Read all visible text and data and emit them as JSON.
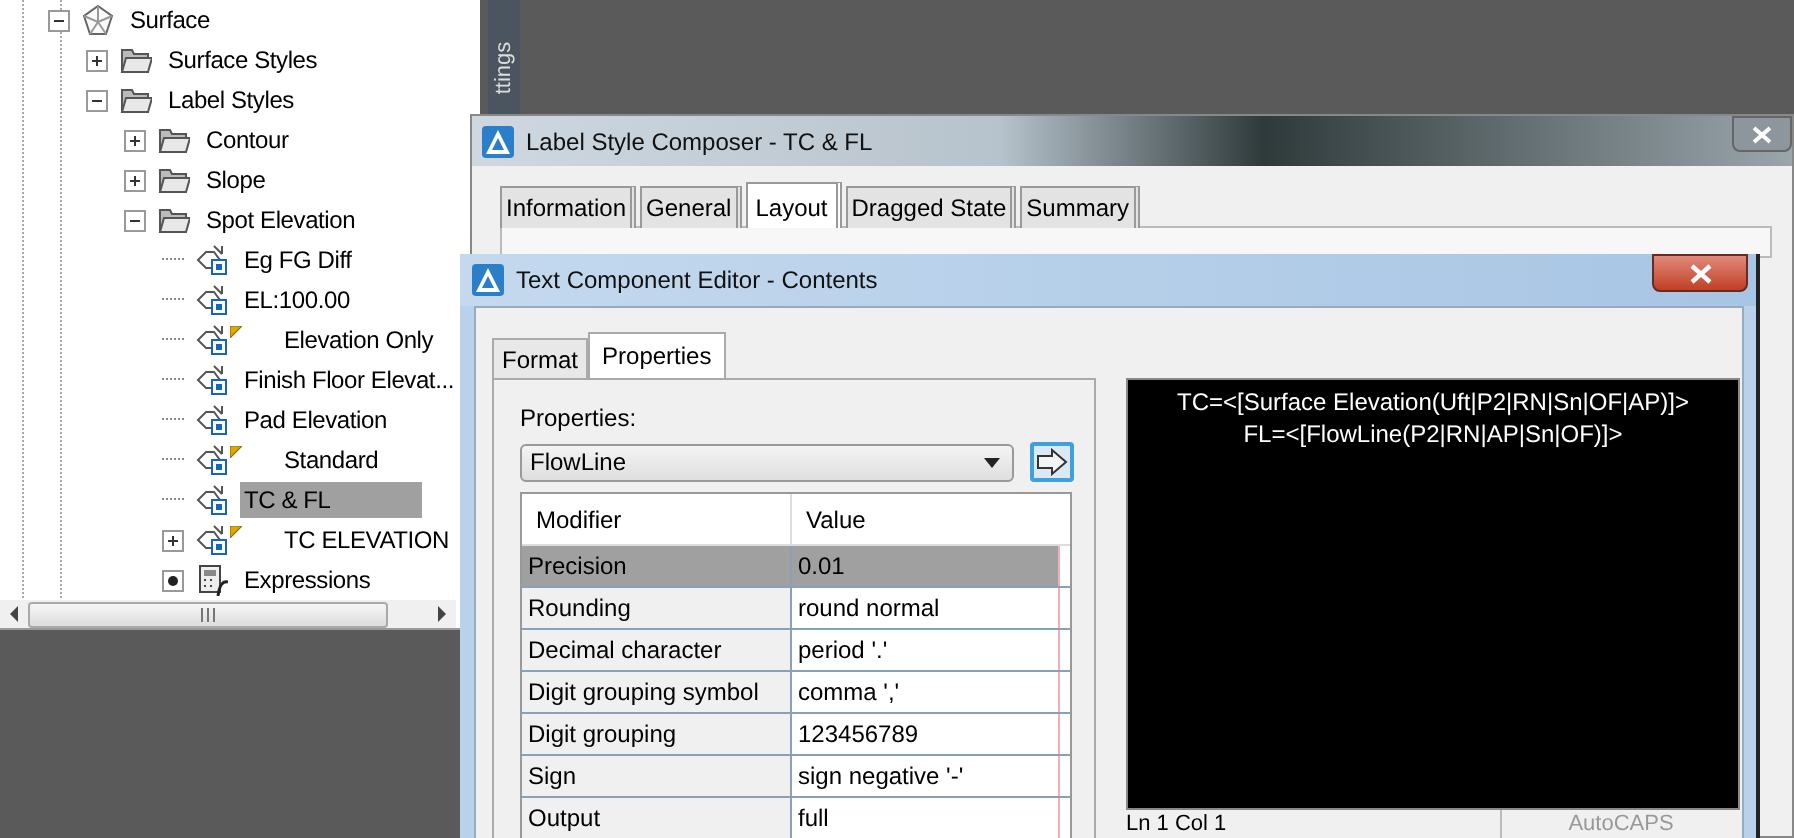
{
  "side_label": "ttings",
  "tree": [
    {
      "label": "Surface",
      "kind": "surface",
      "expanded": true,
      "selected": false,
      "children": [
        {
          "label": "Surface Styles",
          "kind": "folder",
          "expanded": false,
          "selected": false
        },
        {
          "label": "Label Styles",
          "kind": "folder",
          "expanded": true,
          "selected": false,
          "children": [
            {
              "label": "Contour",
              "kind": "folder",
              "expanded": false,
              "selected": false
            },
            {
              "label": "Slope",
              "kind": "folder",
              "expanded": false,
              "selected": false
            },
            {
              "label": "Spot Elevation",
              "kind": "folder",
              "expanded": true,
              "selected": false,
              "children": [
                {
                  "label": "Eg FG Diff",
                  "kind": "label-style",
                  "flagged": false,
                  "selected": false
                },
                {
                  "label": "EL:100.00",
                  "kind": "label-style",
                  "flagged": false,
                  "selected": false
                },
                {
                  "label": "Elevation Only",
                  "kind": "label-style",
                  "flagged": true,
                  "selected": false
                },
                {
                  "label": "Finish Floor Elevat...",
                  "kind": "label-style",
                  "flagged": false,
                  "selected": false
                },
                {
                  "label": "Pad Elevation",
                  "kind": "label-style",
                  "flagged": false,
                  "selected": false
                },
                {
                  "label": "Standard",
                  "kind": "label-style",
                  "flagged": true,
                  "selected": false
                },
                {
                  "label": "TC & FL",
                  "kind": "label-style",
                  "flagged": false,
                  "selected": true
                },
                {
                  "label": "TC ELEVATION",
                  "kind": "label-style",
                  "flagged": true,
                  "expanded": false,
                  "selected": false
                },
                {
                  "label": "Expressions",
                  "kind": "expressions",
                  "selected": false
                }
              ]
            }
          ]
        }
      ]
    }
  ],
  "composer": {
    "title": "Label Style Composer - TC & FL",
    "tabs": [
      {
        "label": "Information",
        "selected": false
      },
      {
        "label": "General",
        "selected": false
      },
      {
        "label": "Layout",
        "selected": true
      },
      {
        "label": "Dragged State",
        "selected": false
      },
      {
        "label": "Summary",
        "selected": false
      }
    ]
  },
  "editor": {
    "title": "Text Component Editor - Contents",
    "tabs": [
      {
        "label": "Format",
        "selected": false
      },
      {
        "label": "Properties",
        "selected": true
      }
    ],
    "properties_label": "Properties:",
    "properties_value": "FlowLine",
    "grid": {
      "columns": [
        "Modifier",
        "Value"
      ],
      "rows": [
        {
          "cells": [
            "Precision",
            "0.01"
          ],
          "selected": true
        },
        {
          "cells": [
            "Rounding",
            "round normal"
          ],
          "selected": false
        },
        {
          "cells": [
            "Decimal character",
            "period '.'"
          ],
          "selected": false
        },
        {
          "cells": [
            "Digit grouping symbol",
            "comma ','"
          ],
          "selected": false
        },
        {
          "cells": [
            "Digit grouping",
            "123456789"
          ],
          "selected": false
        },
        {
          "cells": [
            "Sign",
            "sign negative '-'"
          ],
          "selected": false
        },
        {
          "cells": [
            "Output",
            "full"
          ],
          "selected": false
        }
      ]
    },
    "preview_lines": [
      "TC=<[Surface Elevation(Uft|P2|RN|Sn|OF|AP)]>",
      "FL=<[FlowLine(P2|RN|AP|Sn|OF)]>"
    ],
    "status_bar": [
      {
        "text": "Ln 1 Col 1",
        "disabled": false
      },
      {
        "text": "AutoCAPS",
        "disabled": true
      }
    ]
  }
}
